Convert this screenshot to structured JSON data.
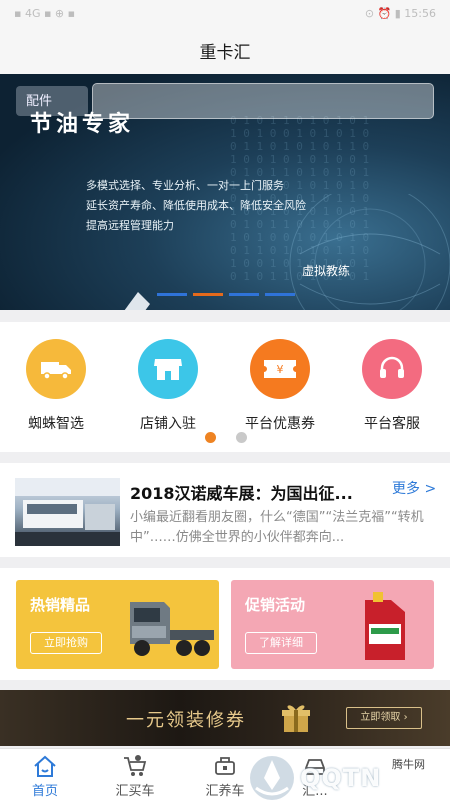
{
  "app": {
    "title": "重卡汇"
  },
  "status_bar": {
    "left": "▪ 4G ▪ ⊕ ▪",
    "right": "⊙ ⏰ ▮ 15:56"
  },
  "banner": {
    "parts_label": "配件",
    "headline": "节油专家",
    "lines": [
      "多模式选择、专业分析、一对一上门服务",
      "延长资产寿命、降低使用成本、降低安全风险",
      "提高远程管理能力"
    ],
    "tag": "虚拟教练",
    "slide_count": 4,
    "active_slide": 1
  },
  "quick_actions": [
    {
      "label": "蜘蛛智选",
      "icon": "truck-icon",
      "color": "#f6b93b"
    },
    {
      "label": "店铺入驻",
      "icon": "shop-icon",
      "color": "#3cc6e8"
    },
    {
      "label": "平台优惠券",
      "icon": "coupon-icon",
      "color": "#f57a1f"
    },
    {
      "label": "平台客服",
      "icon": "headset-icon",
      "color": "#f36b80"
    }
  ],
  "quick_pager": {
    "pages": 2,
    "active": 0
  },
  "news": {
    "title": "2018汉诺威车展：为国出征...",
    "more": "更多 >",
    "desc": "小编最近翻看朋友圈，什么“德国”“法兰克福”“转机中”……仿佛全世界的小伙伴都奔向..."
  },
  "promos": [
    {
      "title": "热销精品",
      "button": "立即抢购",
      "color": "#f4c43d"
    },
    {
      "title": "促销活动",
      "button": "了解详细",
      "color": "#f4a7b4"
    }
  ],
  "ad": {
    "text": "一元领装修券",
    "button": "立即领取 ›"
  },
  "tabs": [
    {
      "label": "首页",
      "icon": "home-icon",
      "active": true
    },
    {
      "label": "汇买车",
      "icon": "cart-icon",
      "active": false
    },
    {
      "label": "汇养车",
      "icon": "maintenance-icon",
      "active": false
    },
    {
      "label": "汇...",
      "icon": "car-icon",
      "active": false
    }
  ],
  "watermark": {
    "text": "QQTN",
    "small": "腾牛网"
  },
  "colors": {
    "accent": "#2e7ad8",
    "orange": "#ee8322"
  }
}
